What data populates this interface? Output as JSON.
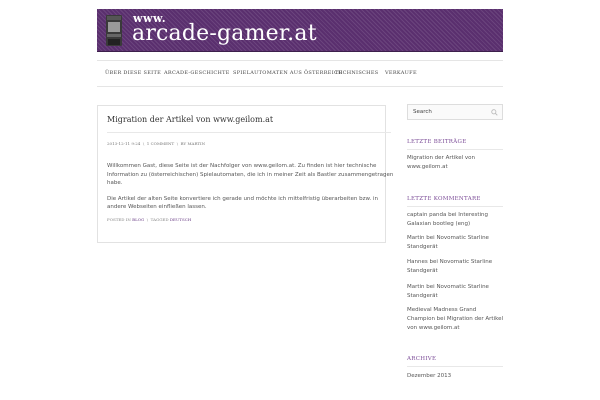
{
  "header": {
    "www": "www.",
    "site_name": "arcade-gamer.at",
    "brand_color": "#5a2f6e",
    "logo_icon": "arcade-cabinet-icon"
  },
  "nav": {
    "items": [
      {
        "label": "ÜBER DIESE SEITE"
      },
      {
        "label": "ARCADE-GESCHICHTE"
      },
      {
        "label": "SPIELAUTOMATEN AUS ÖSTERREICH"
      },
      {
        "label": "TECHNISCHES"
      },
      {
        "label": "VERKAUFE"
      }
    ]
  },
  "post": {
    "title": "Migration der Artikel von www.geilom.at",
    "meta": {
      "date": "2013-12-11 9:24",
      "sep": "\\",
      "comments": "1 COMMENT",
      "by": "BY MARTIN"
    },
    "body": [
      "Willkommen Gast, diese Seite ist der Nachfolger von www.geilom.at. Zu finden ist hier technische Information zu (österreichischen) Spielautomaten, die ich in meiner Zeit als Bastler zusammengetragen habe.",
      "Die Artikel der alten Seite konvertiere ich gerade und möchte ich mittelfristig überarbeiten bzw. in andere Webseiten einfließen lassen."
    ],
    "footer": {
      "posted_in": "POSTED IN",
      "category": "BLOG",
      "sep": "\\",
      "tagged": "TAGGED",
      "tag": "DEUTSCH"
    }
  },
  "sidebar": {
    "search_placeholder": "Search",
    "search_icon": "magnifier-icon",
    "recent_posts": {
      "title": "LETZTE BEITRÄGE",
      "items": [
        "Migration der Artikel von www.geilom.at"
      ]
    },
    "recent_comments": {
      "title": "LETZTE KOMMENTARE",
      "items": [
        "captain panda bei Interesting Galaxian bootleg (eng)",
        "Martin bei Novomatic Starline Standgerät",
        "Hannes bei Novomatic Starline Standgerät",
        "Martin bei Novomatic Starline Standgerät",
        "Medieval Madness Grand Champion bei Migration der Artikel von www.geilom.at"
      ]
    },
    "archive": {
      "title": "ARCHIVE",
      "items": [
        "Dezember 2013"
      ]
    }
  }
}
